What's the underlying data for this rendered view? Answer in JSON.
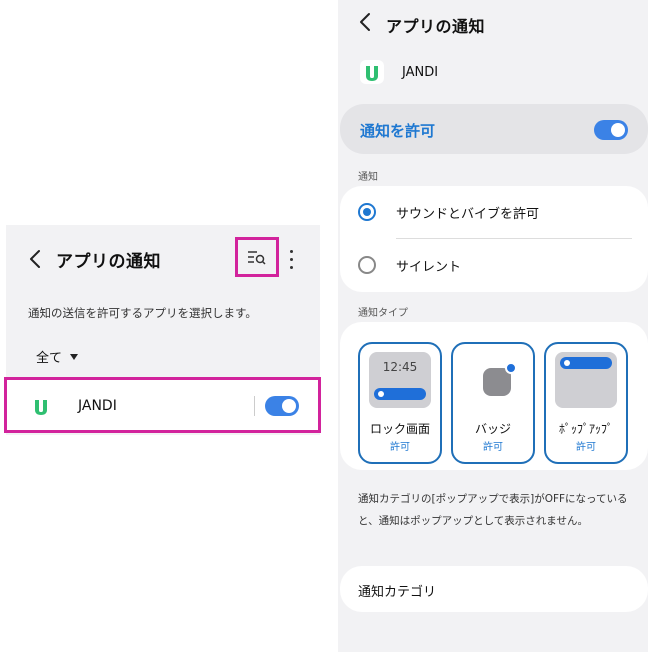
{
  "left_panel": {
    "title": "アプリの通知",
    "description": "通知の送信を許可するアプリを選択します。",
    "filter_label": "全て",
    "app": {
      "name": "JANDI",
      "notifications_enabled": true
    }
  },
  "right_panel": {
    "title": "アプリの通知",
    "app_name": "JANDI",
    "allow_label": "通知を許可",
    "allow_enabled": true,
    "section_notification": "通知",
    "options": [
      {
        "label": "サウンドとバイブを許可",
        "selected": true
      },
      {
        "label": "サイレント",
        "selected": false
      }
    ],
    "section_types": "通知タイプ",
    "types": [
      {
        "label": "ロック画面",
        "status": "許可",
        "clock": "12:45"
      },
      {
        "label": "バッジ",
        "status": "許可"
      },
      {
        "label": "ﾎﾟｯﾌﾟｱｯﾌﾟ",
        "status": "許可"
      }
    ],
    "note": "通知カテゴリの[ポップアップで表示]がOFFになっていると、通知はポップアップとして表示されません。",
    "category_label": "通知カテゴリ"
  },
  "colors": {
    "accent": "#1f78d1",
    "highlight": "#d2239c",
    "app_green": "#2fbf71"
  },
  "icons": [
    "back-arrow-icon",
    "list-search-icon",
    "more-vert-icon",
    "jandi-logo-icon",
    "dropdown-caret-icon"
  ]
}
